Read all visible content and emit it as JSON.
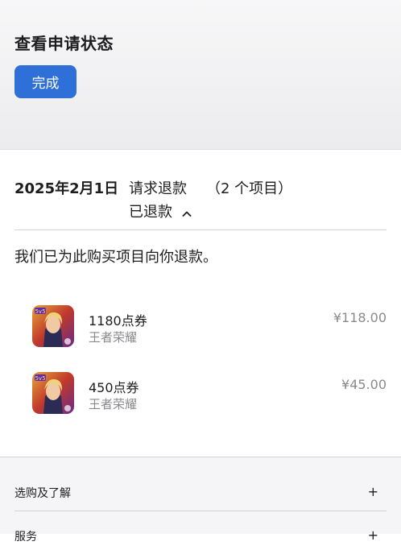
{
  "header": {
    "title": "查看申请状态",
    "done_label": "完成",
    "accent_color": "#2f6fd8"
  },
  "order": {
    "date": "2025年2月1日",
    "type": "请求退款",
    "count": "（2 个项目）",
    "status": "已退款",
    "status_icon": "chevron-up-icon"
  },
  "message": "我们已为此购买项目向你退款。",
  "items": [
    {
      "name": "1180点券",
      "app": "王者荣耀",
      "price": "¥118.00",
      "icon": "game-icon"
    },
    {
      "name": "450点券",
      "app": "王者荣耀",
      "price": "¥45.00",
      "icon": "game-icon"
    }
  ],
  "footer": {
    "items": [
      {
        "label": "选购及了解",
        "icon": "plus-icon"
      },
      {
        "label": "服务",
        "icon": "plus-icon"
      }
    ]
  }
}
